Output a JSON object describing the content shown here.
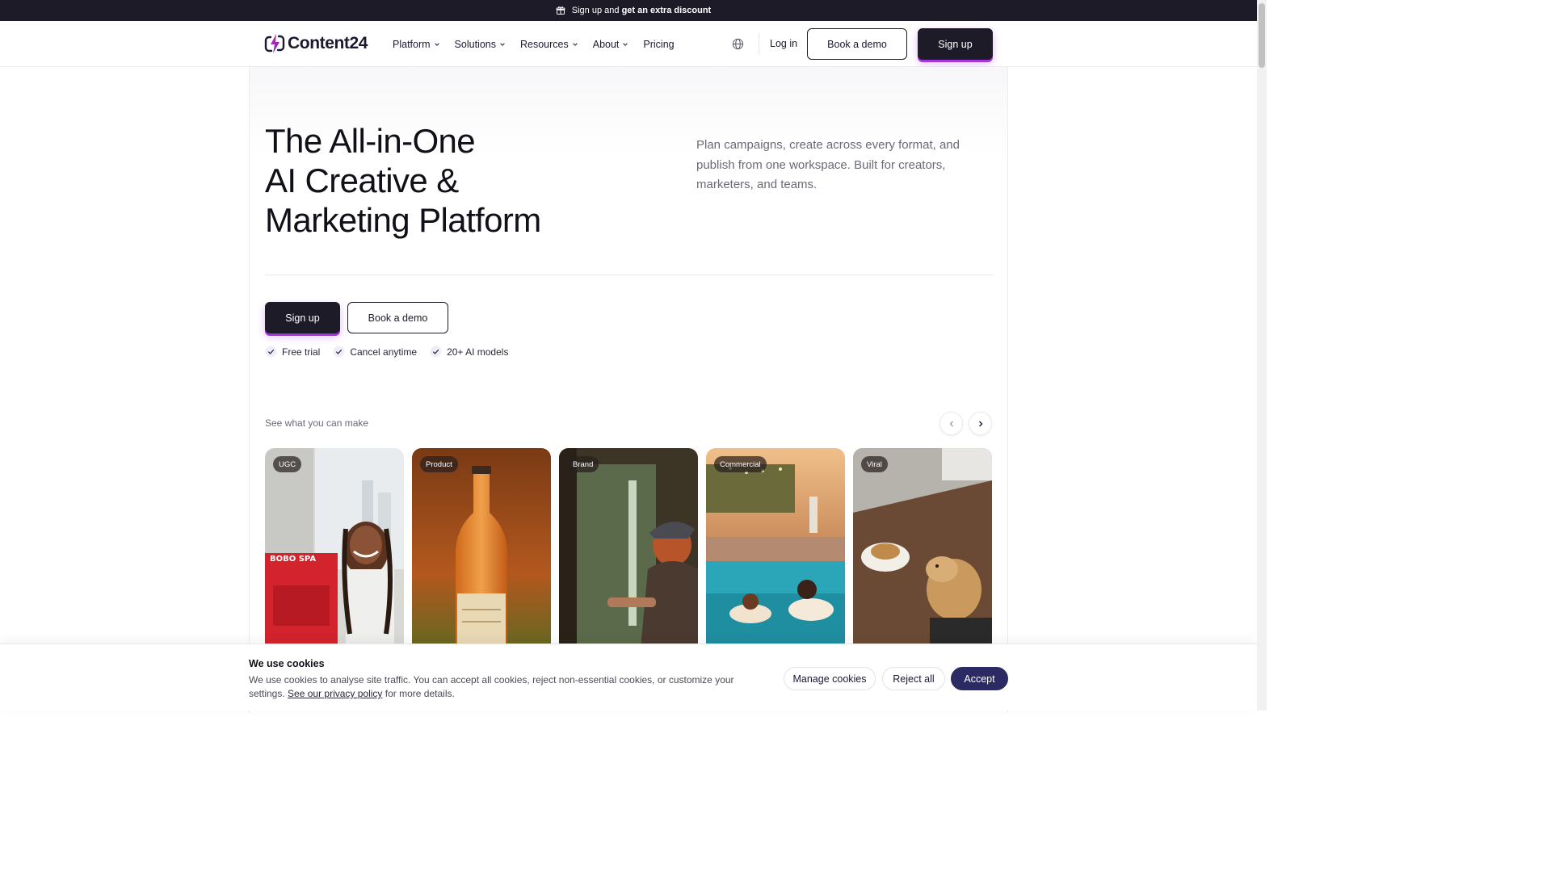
{
  "announcement": {
    "text": "Sign up and",
    "bold": "get an extra discount",
    "icon": "gift-icon"
  },
  "header": {
    "brand": "Content24",
    "nav": [
      {
        "label": "Platform",
        "dropdown": true
      },
      {
        "label": "Solutions",
        "dropdown": true
      },
      {
        "label": "Resources",
        "dropdown": true
      },
      {
        "label": "About",
        "dropdown": true
      },
      {
        "label": "Pricing",
        "dropdown": false
      }
    ],
    "login": "Log in",
    "book_demo": "Book a demo",
    "sign_up": "Sign up"
  },
  "hero": {
    "title_lines": [
      "The All-in-One",
      "AI Creative &",
      "Marketing Platform"
    ],
    "subtitle": "Plan campaigns, create across every format, and publish from one workspace. Built for creators, marketers, and teams.",
    "sign_up": "Sign up",
    "book_demo": "Book a demo",
    "perks": [
      "Free trial",
      "Cancel anytime",
      "20+ AI models"
    ]
  },
  "carousel": {
    "label": "See what you can make",
    "cards": [
      {
        "tag": "UGC"
      },
      {
        "tag": "Product"
      },
      {
        "tag": "Brand"
      },
      {
        "tag": "Commercial"
      },
      {
        "tag": "Viral"
      }
    ]
  },
  "cookie": {
    "title": "We use cookies",
    "text_before": "We use cookies to analyse site traffic. You can accept all cookies, reject non-essential cookies, or customize your settings.",
    "link": "See our privacy policy",
    "text_after": "for more details.",
    "manage": "Manage cookies",
    "reject": "Reject all",
    "accept": "Accept"
  },
  "colors": {
    "dark": "#1e1b29",
    "accent_glow": "#a238d9",
    "accept": "#2b2a63"
  }
}
